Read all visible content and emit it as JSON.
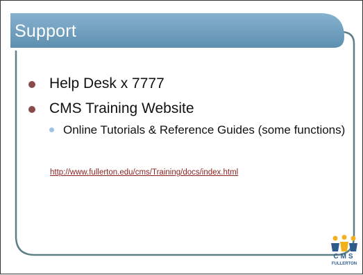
{
  "slide": {
    "title": "Support",
    "bullets": [
      {
        "text": "Help Desk x 7777"
      },
      {
        "text": "CMS Training Website",
        "sub": [
          "Online Tutorials & Reference Guides (some functions)"
        ]
      }
    ],
    "link": "http://www.fullerton.edu/cms/Training/docs/index.html"
  },
  "logo": {
    "name": "cms-fullerton-logo",
    "line1": "CMS",
    "line2": "FULLERTON"
  },
  "colors": {
    "title_bar": "#6a9ab8",
    "frame_stroke": "#5f7f86",
    "bullet_main": "#8a4a4a",
    "bullet_sub": "#9cc3e6",
    "link": "#8b2323"
  }
}
